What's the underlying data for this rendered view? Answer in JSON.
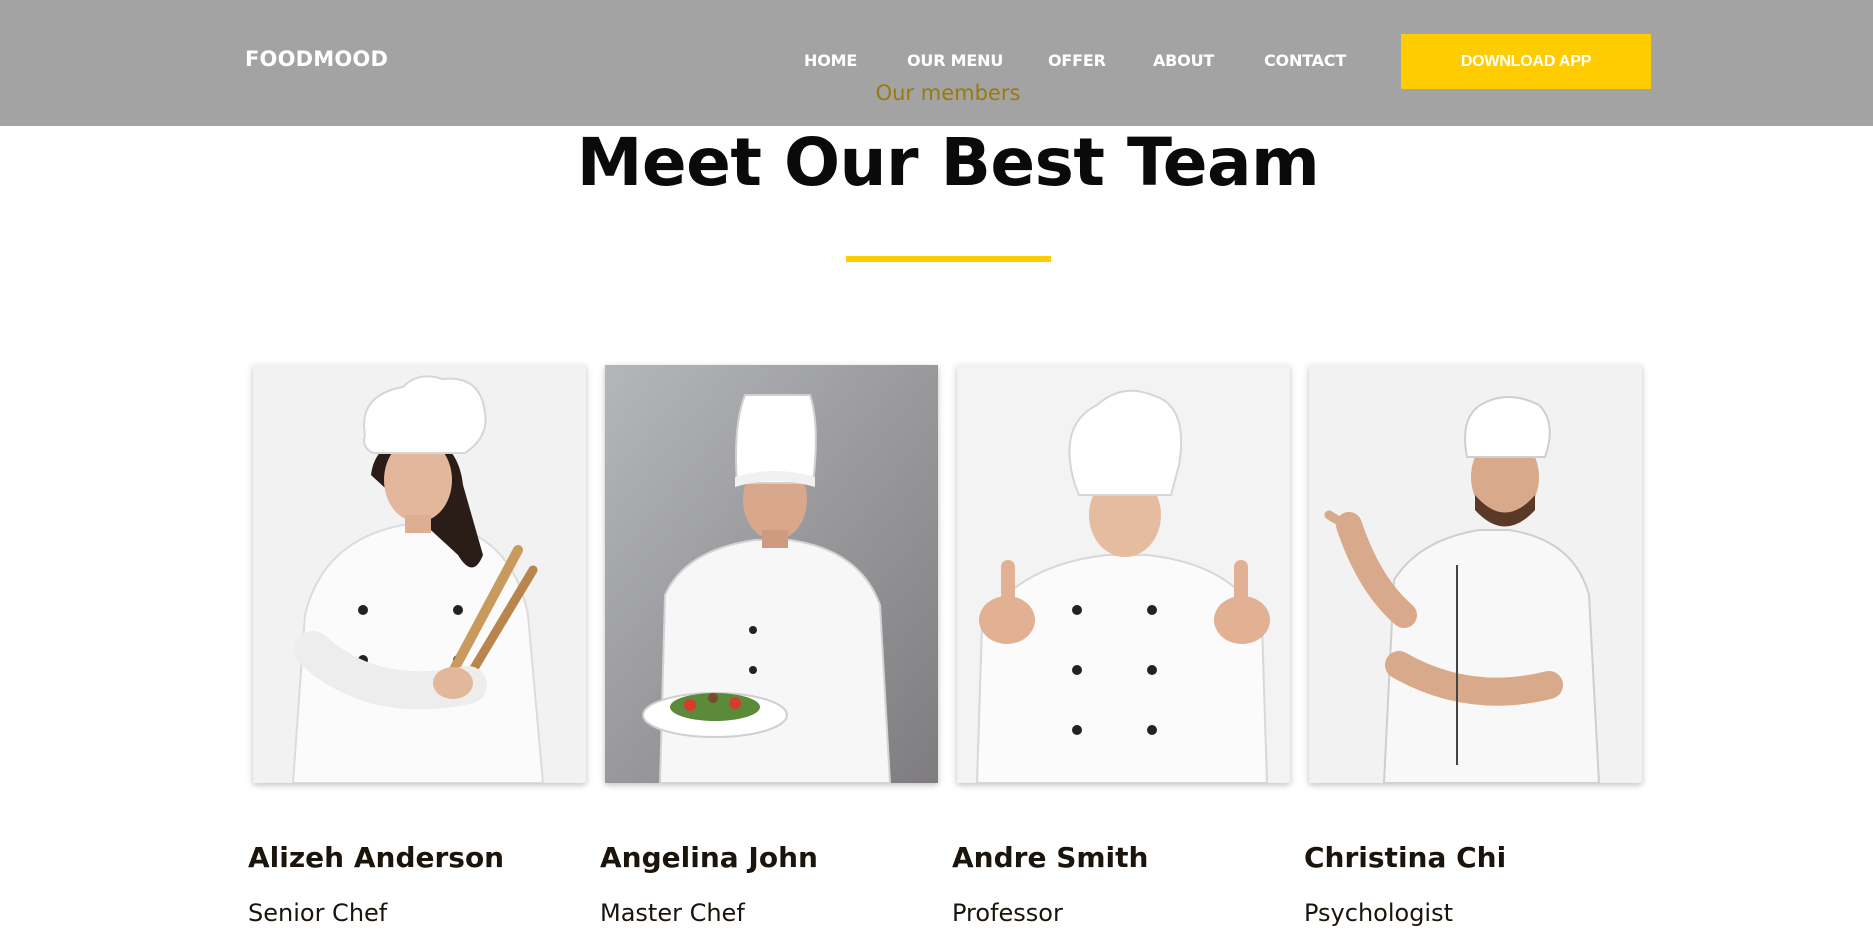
{
  "header": {
    "brand": "FOODMOOD",
    "nav": [
      "HOME",
      "OUR MENU",
      "OFFER",
      "ABOUT",
      "CONTACT"
    ],
    "cta_label": "DOWNLOAD APP",
    "cta_color": "#ffcc00",
    "background": "#a3a3a3"
  },
  "section": {
    "subheading": "Our members",
    "title": "Meet Our Best Team",
    "accent_color": "#ffcc00"
  },
  "team": [
    {
      "name": "Alizeh Anderson",
      "role": "Senior Chef",
      "photo": "chef-woman-with-utensils"
    },
    {
      "name": "Angelina John",
      "role": "Master Chef",
      "photo": "chef-man-with-salad-plate"
    },
    {
      "name": "Andre Smith",
      "role": "Professor",
      "photo": "chef-woman-thumbs-up"
    },
    {
      "name": "Christina Chi",
      "role": "Psychologist",
      "photo": "chef-man-pointing"
    }
  ]
}
